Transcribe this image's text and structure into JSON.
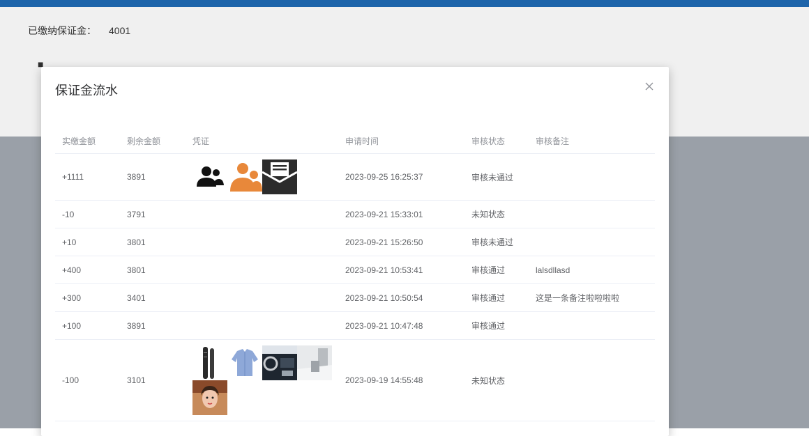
{
  "page": {
    "deposit_label": "已缴纳保证金：",
    "deposit_value": "4001"
  },
  "modal": {
    "title": "保证金流水",
    "close_icon": "close-icon",
    "columns": [
      "实缴金额",
      "剩余金额",
      "凭证",
      "申请时间",
      "审核状态",
      "审核备注"
    ],
    "rows": [
      {
        "paid": "+1111",
        "remaining": "3891",
        "time": "2023-09-25 16:25:37",
        "status": "审核未通过",
        "remark": "",
        "proofs": [
          "users-icon",
          "people-icon",
          "inbox-icon"
        ]
      },
      {
        "paid": "-10",
        "remaining": "3791",
        "time": "2023-09-21 15:33:01",
        "status": "未知状态",
        "remark": "",
        "proofs": []
      },
      {
        "paid": "+10",
        "remaining": "3801",
        "time": "2023-09-21 15:26:50",
        "status": "审核未通过",
        "remark": "",
        "proofs": []
      },
      {
        "paid": "+400",
        "remaining": "3801",
        "time": "2023-09-21 10:53:41",
        "status": "审核通过",
        "remark": "lalsdllasd",
        "proofs": []
      },
      {
        "paid": "+300",
        "remaining": "3401",
        "time": "2023-09-21 10:50:54",
        "status": "审核通过",
        "remark": "这是一条备注啦啦啦啦",
        "proofs": []
      },
      {
        "paid": "+100",
        "remaining": "3891",
        "time": "2023-09-21 10:47:48",
        "status": "审核通过",
        "remark": "",
        "proofs": []
      },
      {
        "paid": "-100",
        "remaining": "3101",
        "time": "2023-09-19 14:55:48",
        "status": "未知状态",
        "remark": "",
        "proofs": [
          "hair-brush-photo",
          "shirt-photo",
          "car-interior-photo",
          "room-photo",
          "portrait-photo"
        ]
      }
    ]
  },
  "colors": {
    "topbar": "#1f6bb5",
    "accent_orange": "#e8883a"
  }
}
